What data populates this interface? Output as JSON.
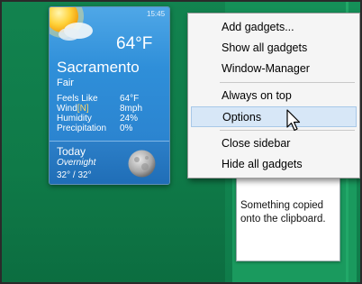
{
  "weather": {
    "time": "15:45",
    "temperature": "64°F",
    "city": "Sacramento",
    "condition": "Fair",
    "details": [
      {
        "label": "Feels Like",
        "value": "64°F"
      },
      {
        "label_prefix": "Wind",
        "label_bracket": "[N]",
        "value": "8mph"
      },
      {
        "label": "Humidity",
        "value": "24%"
      },
      {
        "label": "Precipitation",
        "value": "0%"
      }
    ],
    "forecast": {
      "day": "Today",
      "period": "Overnight",
      "range": "32° /  32°"
    }
  },
  "clipboard": {
    "text": "Something copied onto the clipboard."
  },
  "context_menu": {
    "items": [
      {
        "label": "Add gadgets..."
      },
      {
        "label": "Show all gadgets"
      },
      {
        "label": "Window-Manager"
      },
      {
        "label": "Always on top"
      },
      {
        "label": "Options",
        "highlighted": true
      },
      {
        "label": "Close sidebar"
      },
      {
        "label": "Hide all gadgets"
      }
    ]
  },
  "colors": {
    "desktop": "#12834f",
    "weather_panel": "#2f8fd9",
    "menu_highlight": "#d7e7f7"
  }
}
